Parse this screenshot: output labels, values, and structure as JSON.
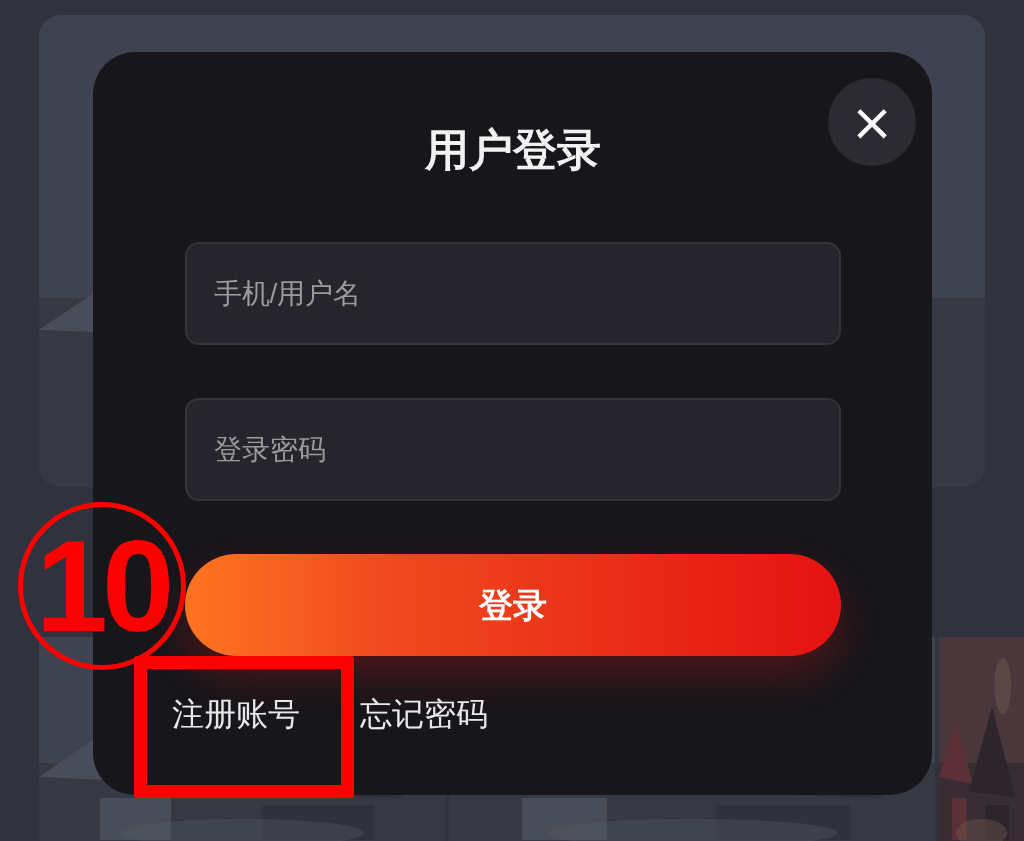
{
  "dialog": {
    "title": "用户登录",
    "close_label": "×",
    "fields": [
      {
        "placeholder": "手机/用户名"
      },
      {
        "placeholder": "登录密码"
      }
    ],
    "submit": "登录",
    "links": [
      "注册账号",
      "忘记密码"
    ]
  },
  "annotation": {
    "label": "10"
  }
}
